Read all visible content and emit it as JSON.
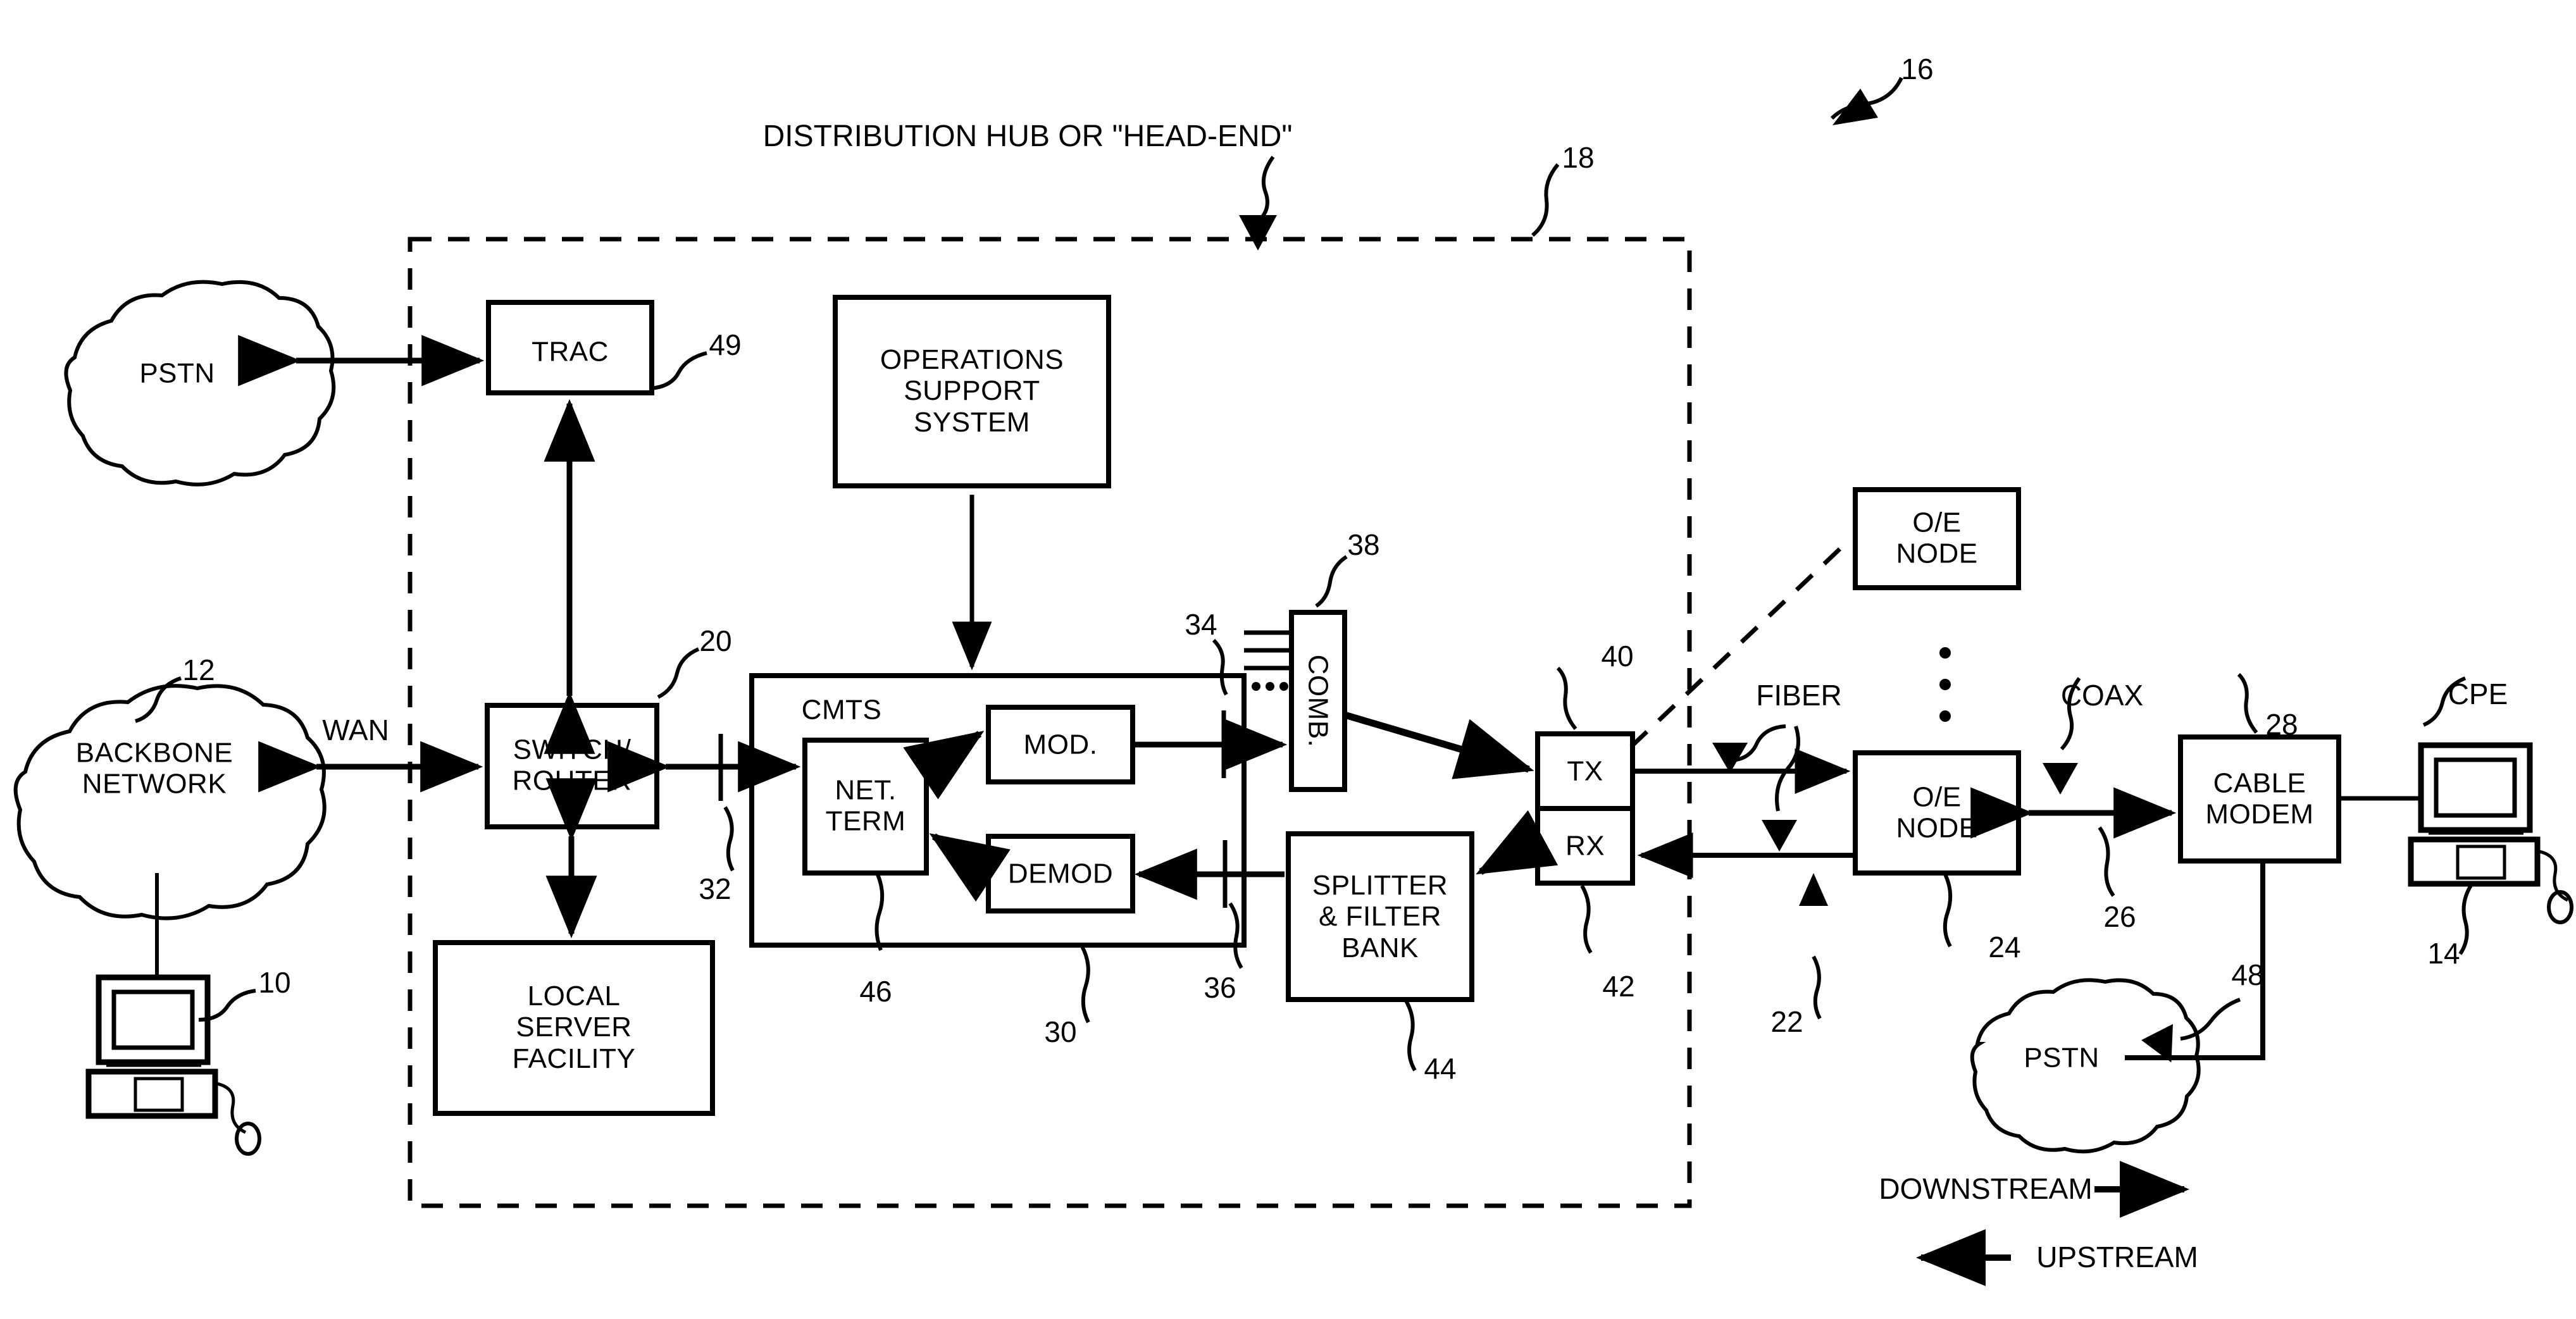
{
  "figure": {
    "title": "DISTRIBUTION HUB OR \"HEAD-END\"",
    "system_ref": "16",
    "headend_ref": "18"
  },
  "boxes": {
    "trac": "TRAC",
    "oss": "OPERATIONS\nSUPPORT\nSYSTEM",
    "switch_router": "SWiTCH/\nROUTER",
    "local_server": "LOCAL\nSERVER\nFACILITY",
    "cmts": "CMTS",
    "net_term": "NET.\nTERM",
    "mod": "MOD.",
    "demod": "DEMOD",
    "comb": "COMB.",
    "splitter": "SPLITTER\n& FILTER\nBANK",
    "tx": "TX",
    "rx": "RX",
    "oe_node_top": "O/E\nNODE",
    "oe_node_main": "O/E\nNODE",
    "cable_modem": "CABLE\nMODEM"
  },
  "clouds": {
    "pstn_top": "PSTN",
    "backbone": "BACKBONE\nNETWORK",
    "pstn_bottom": "PSTN"
  },
  "link_labels": {
    "wan": "WAN",
    "fiber": "FIBER",
    "coax": "COAX",
    "cpe": "CPE"
  },
  "reference_numerals": {
    "n10": "10",
    "n12": "12",
    "n14": "14",
    "n16": "16",
    "n18": "18",
    "n20": "20",
    "n22": "22",
    "n24": "24",
    "n26": "26",
    "n28": "28",
    "n30": "30",
    "n32": "32",
    "n34": "34",
    "n36": "36",
    "n38": "38",
    "n40": "40",
    "n42": "42",
    "n44": "44",
    "n46": "46",
    "n48": "48",
    "n49": "49"
  },
  "legend": {
    "downstream": "DOWNSTREAM",
    "upstream": "UPSTREAM"
  },
  "colors": {
    "ink": "#000000",
    "paper": "#ffffff"
  }
}
